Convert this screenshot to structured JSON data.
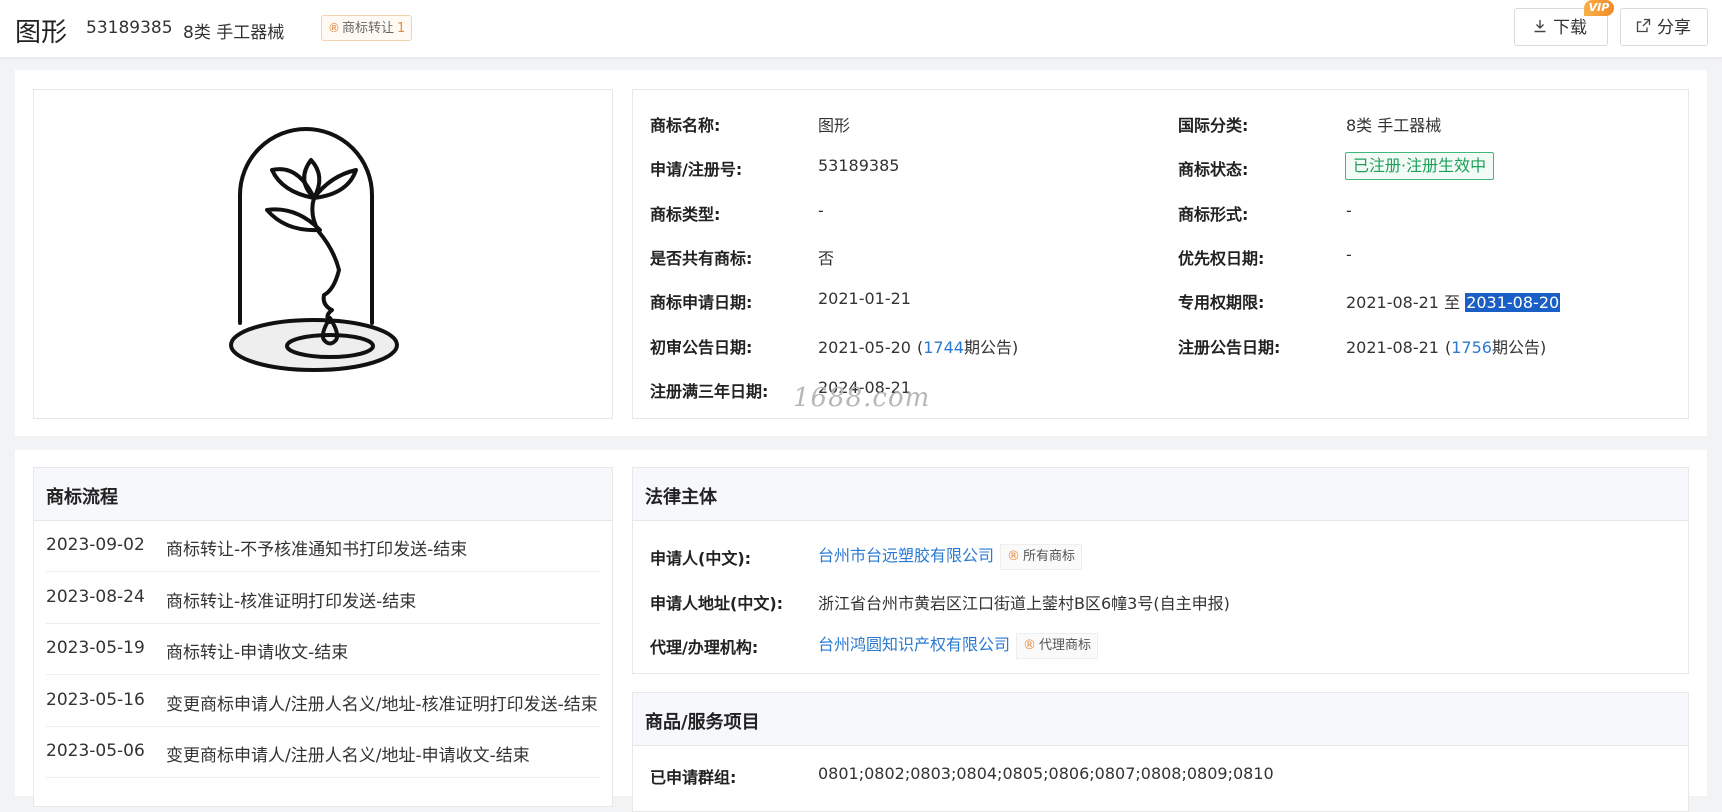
{
  "header": {
    "title": "图形",
    "number": "53189385",
    "category": "8类 手工器械",
    "transfer_badge": "商标转让",
    "transfer_count": "1",
    "download_label": "下载",
    "share_label": "分享",
    "vip_label": "VIP"
  },
  "info": {
    "name_label": "商标名称:",
    "name_value": "图形",
    "intl_class_label": "国际分类:",
    "intl_class_value": "8类 手工器械",
    "reg_no_label": "申请/注册号:",
    "reg_no_value": "53189385",
    "status_label": "商标状态:",
    "status_value": "已注册·注册生效中",
    "type_label": "商标类型:",
    "type_value": "-",
    "form_label": "商标形式:",
    "form_value": "-",
    "shared_label": "是否共有商标:",
    "shared_value": "否",
    "priority_label": "优先权日期:",
    "priority_value": "-",
    "apply_date_label": "商标申请日期:",
    "apply_date_value": "2021-01-21",
    "exclusive_label": "专用权期限:",
    "exclusive_start": "2021-08-21",
    "exclusive_to": "至",
    "exclusive_end": "2031-08-20",
    "prelim_label": "初审公告日期:",
    "prelim_date": "2021-05-20",
    "prelim_issue": "1744",
    "prelim_suffix": "期公告)",
    "reg_pub_label": "注册公告日期:",
    "reg_pub_date": "2021-08-21",
    "reg_pub_issue": "1756",
    "reg_pub_suffix": "期公告)",
    "three_year_label": "注册满三年日期:",
    "three_year_value": "2024-08-21",
    "paren_open": "(",
    "watermark": "1688.com"
  },
  "flow": {
    "title": "商标流程",
    "rows": [
      {
        "date": "2023-09-02",
        "text": "商标转让-不予核准通知书打印发送-结束"
      },
      {
        "date": "2023-08-24",
        "text": "商标转让-核准证明打印发送-结束"
      },
      {
        "date": "2023-05-19",
        "text": "商标转让-申请收文-结束"
      },
      {
        "date": "2023-05-16",
        "text": "变更商标申请人/注册人名义/地址-核准证明打印发送-结束"
      },
      {
        "date": "2023-05-06",
        "text": "变更商标申请人/注册人名义/地址-申请收文-结束"
      }
    ]
  },
  "legal": {
    "title": "法律主体",
    "applicant_label": "申请人(中文):",
    "applicant_value": "台州市台远塑胶有限公司",
    "applicant_tag": "所有商标",
    "address_label": "申请人地址(中文):",
    "address_value": "浙江省台州市黄岩区江口街道上蓥村B区6幢3号(自主申报)",
    "agent_label": "代理/办理机构:",
    "agent_value": "台州鸿圆知识产权有限公司",
    "agent_tag": "代理商标"
  },
  "goods": {
    "title": "商品/服务项目",
    "groups_label": "已申请群组:",
    "groups_value": "0801;0802;0803;0804;0805;0806;0807;0808;0809;0810"
  },
  "colors": {
    "accent_blue": "#2a7ad2",
    "status_green": "#1fa05a",
    "badge_orange": "#e9893b"
  }
}
